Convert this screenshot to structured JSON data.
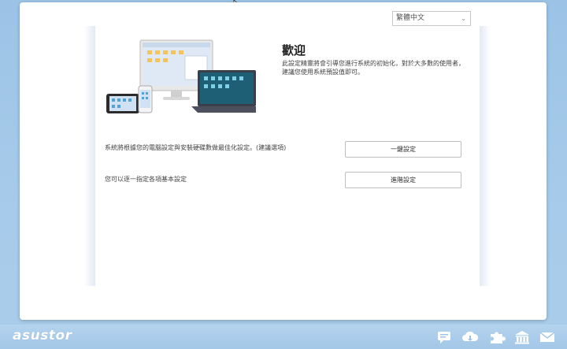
{
  "language": {
    "selected": "繁體中文"
  },
  "welcome": {
    "title": "歡迎",
    "description": "此設定精靈將會引導您進行系統的初始化，對於大多數的使用者，建議您使用系統預設值即可。"
  },
  "options": [
    {
      "text": "系統將根據您的電腦設定與安裝硬碟數做最佳化設定。(建議選項)",
      "button": "一鍵設定"
    },
    {
      "text": "您可以逐一指定各項基本設定",
      "button": "進階設定"
    }
  ],
  "taskbar": {
    "logo": "asustor",
    "icons": [
      "chat-icon",
      "cloud-download-icon",
      "puzzle-icon",
      "bank-icon",
      "mail-icon"
    ]
  }
}
